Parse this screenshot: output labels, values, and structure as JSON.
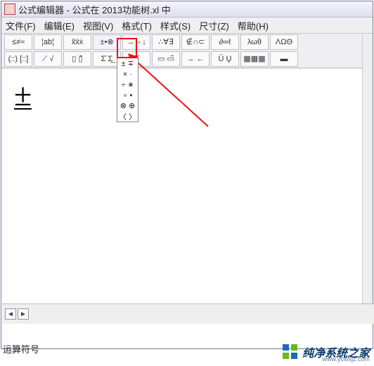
{
  "title": "公式编辑器 - 公式在 2013功能树.xl 中",
  "menu": {
    "m0": "文件(F)",
    "m1": "编辑(E)",
    "m2": "视图(V)",
    "m3": "格式(T)",
    "m4": "样式(S)",
    "m5": "尺寸(Z)",
    "m6": "帮助(H)"
  },
  "toolbar_row1": {
    "b0": "≤≠≈",
    "b1": "¦ab¦",
    "b2": "x͂ẍẋ",
    "b3": "±•⊗",
    "b4": "→⇔↓",
    "b5": "∴∀∃",
    "b6": "∉∩⊂",
    "b7": "∂∞ℓ",
    "b8": "λωθ",
    "b9": "ΛΩΘ"
  },
  "toolbar_row2": {
    "b0": "(::) [::]",
    "b1": "⟋ √",
    "b2": "▯ ▯̄",
    "b3": "Σ̄ Σ̲",
    "b4": "∫∮",
    "b5": "▭ ▭̄",
    "b6": "→ ←",
    "b7": "Ū Ų",
    "b8": "▦▦▦",
    "b9": "▬"
  },
  "selected_symbol_btn": "±",
  "dropdown_items": {
    "d0": "± ∓",
    "d1": "× ·",
    "d2": "÷ ∗",
    "d3": "∘ •",
    "d4": "⊗ ⊕",
    "d5": "〈 〉"
  },
  "canvas": {
    "symbol": "±"
  },
  "status": {
    "text": "运算符号",
    "left_arrow": "◄",
    "right_arrow": "►"
  },
  "brand": {
    "name": "纯净系统之家",
    "url": "www.ycwxjz.com"
  },
  "colors": {
    "highlight": "#f01010",
    "brand_blue": "#1a6ab8",
    "brand_green": "#6ab81a"
  }
}
